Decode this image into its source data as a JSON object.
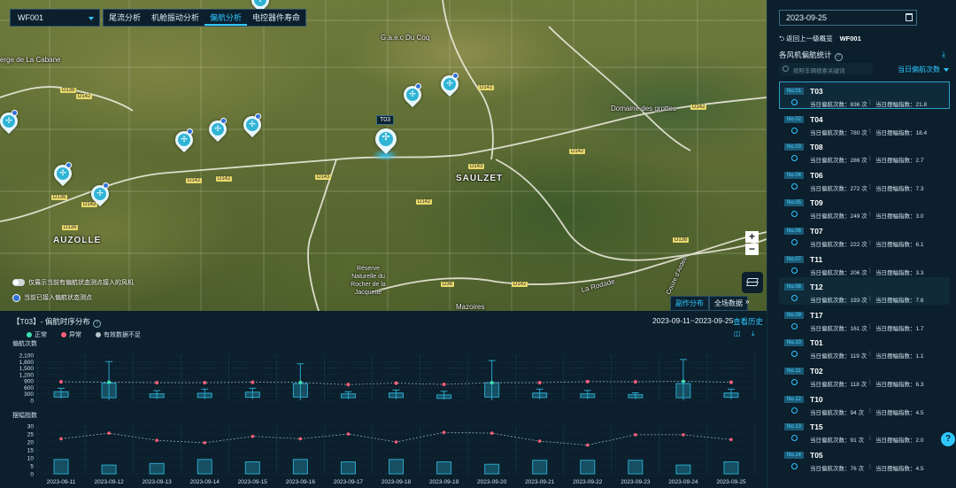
{
  "map": {
    "farm_select": "WF001",
    "tabs": [
      {
        "label": "尾流分析",
        "active": false
      },
      {
        "label": "机舱振动分析",
        "active": false
      },
      {
        "label": "偏航分析",
        "active": true
      },
      {
        "label": "电控器件寿命",
        "active": false
      }
    ],
    "places": [
      "G.a.e.c Du Coq",
      "erge de La Cabane",
      "Domaine des grottes",
      "SAULZET",
      "AUZOLLE",
      "Réserve Naturelle du Rocher de la Jacquette",
      "Mazoires",
      "La Rodade",
      "Couze d'Ardes"
    ],
    "roads": [
      "D136",
      "D142",
      "D142",
      "D142",
      "D143",
      "D142",
      "D142",
      "D142",
      "D143",
      "D136",
      "D136",
      "D142",
      "D136",
      "D142",
      "D36",
      "D142"
    ],
    "selected_tag": "T03",
    "toggle_1": "仅展示当前有偏航状态测点接入的风机",
    "toggle_2": "当前已接入偏航状态测点",
    "zoom_in": "+",
    "zoom_out": "−",
    "btn_distribution": "副作分布",
    "btn_full": "全场数据",
    "collapse": "»"
  },
  "bottom": {
    "title": "【T03】- 偏航时序分布",
    "range": "2023-09-11~2023-09-25",
    "history": "查看历史",
    "legend": [
      {
        "label": "正常",
        "color": "#3ee0b0"
      },
      {
        "label": "异常",
        "color": "#ff5e7a"
      },
      {
        "label": "有效数据不足",
        "color": "#b7c3c9"
      }
    ]
  },
  "right": {
    "date": "2023-09-25",
    "back": "返回上一级概览",
    "farm": "WF001",
    "stat_title": "各风机偏航统计",
    "search_placeholder": "按照车辆搜索关键词",
    "sort": "当日偏航次数",
    "count_label": "当日偏航次数：",
    "index_label": "当日摆幅指数：",
    "sep": "|",
    "items": [
      {
        "no": "No.01",
        "name": "T03",
        "count": "836 次",
        "index": "21.8"
      },
      {
        "no": "No.02",
        "name": "T04",
        "count": "780 次",
        "index": "18.4"
      },
      {
        "no": "No.03",
        "name": "T08",
        "count": "286 次",
        "index": "2.7"
      },
      {
        "no": "No.04",
        "name": "T06",
        "count": "272 次",
        "index": "7.3"
      },
      {
        "no": "No.05",
        "name": "T09",
        "count": "249 次",
        "index": "3.0"
      },
      {
        "no": "No.06",
        "name": "T07",
        "count": "222 次",
        "index": "6.1"
      },
      {
        "no": "No.07",
        "name": "T11",
        "count": "206 次",
        "index": "3.3"
      },
      {
        "no": "No.08",
        "name": "T12",
        "count": "193 次",
        "index": "7.6"
      },
      {
        "no": "No.09",
        "name": "T17",
        "count": "161 次",
        "index": "1.7"
      },
      {
        "no": "No.10",
        "name": "T01",
        "count": "119 次",
        "index": "1.1"
      },
      {
        "no": "No.11",
        "name": "T02",
        "count": "118 次",
        "index": "6.3"
      },
      {
        "no": "No.12",
        "name": "T10",
        "count": "94 次",
        "index": "4.5"
      },
      {
        "no": "No.13",
        "name": "T15",
        "count": "91 次",
        "index": "2.0"
      },
      {
        "no": "No.14",
        "name": "T05",
        "count": "76 次",
        "index": "4.5"
      }
    ]
  },
  "chart_data": [
    {
      "type": "box",
      "ylabel": "偏航次数",
      "yticks": [
        "2,100",
        "1,800",
        "1,500",
        "1,200",
        "900",
        "600",
        "300",
        "0"
      ],
      "ylim": [
        0,
        2100
      ],
      "categories": [
        "2023-09-11",
        "2023-09-12",
        "2023-09-13",
        "2023-09-14",
        "2023-09-15",
        "2023-09-16",
        "2023-09-17",
        "2023-09-18",
        "2023-09-19",
        "2023-09-20",
        "2023-09-21",
        "2023-09-22",
        "2023-09-23",
        "2023-09-24",
        "2023-09-25"
      ],
      "boxes": [
        {
          "min": 80,
          "q1": 150,
          "q3": 400,
          "max": 560
        },
        {
          "min": 0,
          "q1": 120,
          "q3": 800,
          "max": 1800
        },
        {
          "min": 60,
          "q1": 130,
          "q3": 300,
          "max": 450
        },
        {
          "min": 60,
          "q1": 130,
          "q3": 330,
          "max": 520
        },
        {
          "min": 60,
          "q1": 140,
          "q3": 380,
          "max": 560
        },
        {
          "min": 0,
          "q1": 150,
          "q3": 780,
          "max": 1700
        },
        {
          "min": 60,
          "q1": 120,
          "q3": 300,
          "max": 400
        },
        {
          "min": 60,
          "q1": 130,
          "q3": 340,
          "max": 480
        },
        {
          "min": 40,
          "q1": 90,
          "q3": 250,
          "max": 420
        },
        {
          "min": 0,
          "q1": 150,
          "q3": 820,
          "max": 1850
        },
        {
          "min": 60,
          "q1": 130,
          "q3": 340,
          "max": 520
        },
        {
          "min": 60,
          "q1": 130,
          "q3": 300,
          "max": 460
        },
        {
          "min": 60,
          "q1": 120,
          "q3": 260,
          "max": 350
        },
        {
          "min": 0,
          "q1": 120,
          "q3": 780,
          "max": 1900
        },
        {
          "min": 60,
          "q1": 140,
          "q3": 340,
          "max": 520
        }
      ],
      "daily_values": [
        860,
        840,
        820,
        820,
        840,
        830,
        730,
        800,
        740,
        820,
        820,
        870,
        860,
        880,
        840
      ],
      "daily_status": [
        "abnormal",
        "normal",
        "abnormal",
        "abnormal",
        "abnormal",
        "normal",
        "abnormal",
        "abnormal",
        "abnormal",
        "normal",
        "abnormal",
        "abnormal",
        "abnormal",
        "normal",
        "abnormal"
      ]
    },
    {
      "type": "bar",
      "ylabel": "摆幅指数",
      "yticks": [
        "30",
        "25",
        "20",
        "15",
        "10",
        "5",
        "0"
      ],
      "ylim": [
        0,
        30
      ],
      "categories": [
        "2023-09-11",
        "2023-09-12",
        "2023-09-13",
        "2023-09-14",
        "2023-09-15",
        "2023-09-16",
        "2023-09-17",
        "2023-09-18",
        "2023-09-19",
        "2023-09-20",
        "2023-09-21",
        "2023-09-22",
        "2023-09-23",
        "2023-09-24",
        "2023-09-25"
      ],
      "values": [
        9,
        5.5,
        6.5,
        9,
        7.5,
        9,
        7.5,
        9,
        7.5,
        6,
        8.5,
        8.5,
        8.5,
        5.5,
        7.5
      ],
      "line": [
        22,
        25.5,
        21,
        19.5,
        23.5,
        22,
        25,
        20,
        26,
        25.5,
        20.5,
        18,
        24.5,
        24.5,
        21.5
      ]
    }
  ]
}
